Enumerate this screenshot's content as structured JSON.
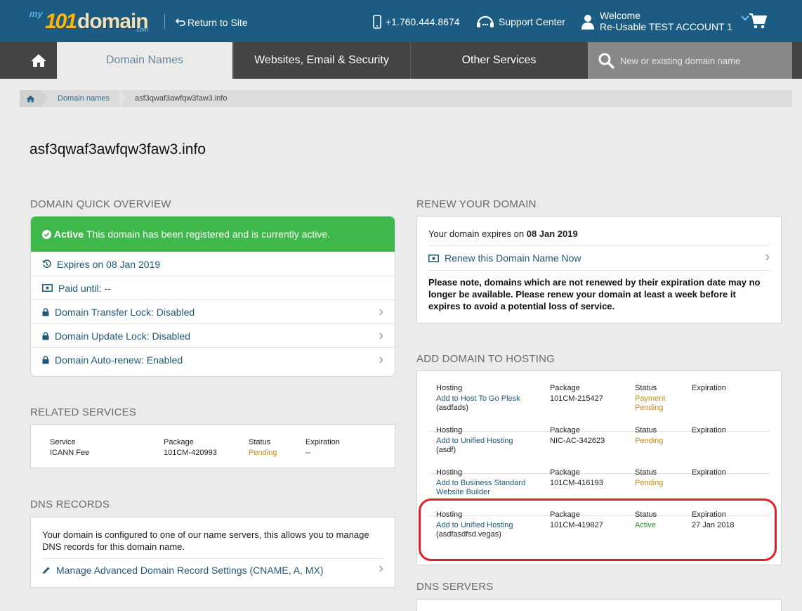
{
  "header": {
    "logo": {
      "my": "my",
      "num": "101",
      "word": "domain",
      "com": ".com"
    },
    "return_to_site": "Return to Site",
    "phone": "+1.760.444.8674",
    "support": "Support Center",
    "welcome": "Welcome",
    "account": "Re-Usable TEST ACCOUNT 1"
  },
  "nav": {
    "tabs": [
      {
        "label": "Domain Names",
        "active": true
      },
      {
        "label": "Websites, Email & Security",
        "active": false
      },
      {
        "label": "Other Services",
        "active": false
      }
    ],
    "search_placeholder": "New or existing domain name"
  },
  "breadcrumb": {
    "link": "Domain names",
    "current": "asf3qwaf3awfqw3faw3.info"
  },
  "page_title": "asf3qwaf3awfqw3faw3.info",
  "overview": {
    "heading": "DOMAIN QUICK OVERVIEW",
    "active_label": "Active",
    "active_text": "This domain has been registered and is currently active.",
    "expires": "Expires on 08 Jan 2019",
    "paid_until": "Paid until: --",
    "transfer_lock": "Domain Transfer Lock: Disabled",
    "update_lock": "Domain Update Lock: Disabled",
    "auto_renew": "Domain Auto-renew: Enabled"
  },
  "related": {
    "heading": "RELATED SERVICES",
    "headers": {
      "service": "Service",
      "package": "Package",
      "status": "Status",
      "expiration": "Expiration"
    },
    "row": {
      "service": "ICANN Fee",
      "package": "101CM-420993",
      "status": "Pending",
      "expiration": "--"
    }
  },
  "dns_records": {
    "heading": "DNS RECORDS",
    "text": "Your domain is configured to one of our name servers, this allows you to manage DNS records for this domain name.",
    "manage": "Manage Advanced Domain Record Settings (CNAME, A, MX)"
  },
  "renew": {
    "heading": "RENEW YOUR DOMAIN",
    "expires_prefix": "Your domain expires on ",
    "expires_date": "08 Jan 2019",
    "renew_link": "Renew this Domain Name Now",
    "note": "Please note, domains which are not renewed by their expiration date may no longer be available. Please renew your domain at least a week before it expires to avoid a potential loss of service."
  },
  "hosting": {
    "heading": "ADD DOMAIN TO HOSTING",
    "headers": {
      "hosting": "Hosting",
      "package": "Package",
      "status": "Status",
      "expiration": "Expiration"
    },
    "rows": [
      {
        "link": "Add to Host To Go Plesk",
        "sub": "(asdfads)",
        "package": "101CM-215427",
        "status": "Payment Pending",
        "expiration": ""
      },
      {
        "link": "Add to Unified Hosting",
        "sub": "(asdf)",
        "package": "NIC-AC-342623",
        "status": "Pending",
        "expiration": ""
      },
      {
        "link": "Add to Business Standard Website Builder",
        "sub": "",
        "package": "101CM-416193",
        "status": "Pending",
        "expiration": ""
      },
      {
        "link": "Add to Unified Hosting",
        "sub": "(asdfasdfsd.vegas)",
        "package": "101CM-419827",
        "status": "Active",
        "expiration": "27 Jan 2018"
      }
    ]
  },
  "dns_servers": {
    "heading": "DNS SERVERS"
  },
  "colors": {
    "header": "#1d5c82",
    "nav": "#444444",
    "active_green": "#3eb84b",
    "link": "#1f5878",
    "pending": "#c68a1b",
    "highlight": "#e01e25"
  }
}
